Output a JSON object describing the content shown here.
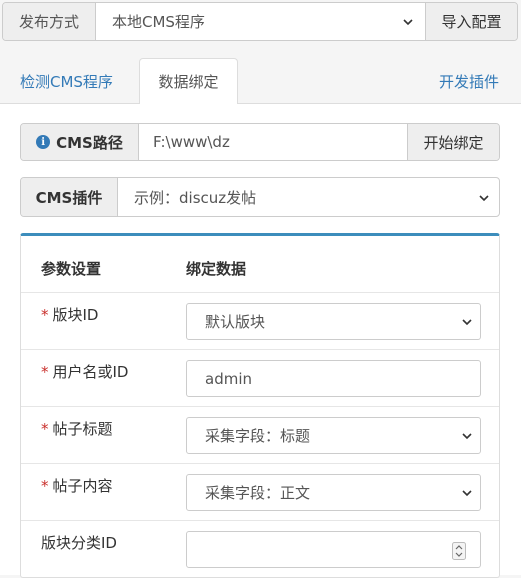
{
  "publish": {
    "label": "发布方式",
    "selected": "本地CMS程序",
    "import_button": "导入配置"
  },
  "tabs": [
    {
      "label": "检测CMS程序"
    },
    {
      "label": "数据绑定"
    },
    {
      "label": "开发插件"
    }
  ],
  "cms_path": {
    "label": "CMS路径",
    "value": "F:\\www\\dz",
    "button": "开始绑定"
  },
  "cms_plugin": {
    "label": "CMS插件",
    "selected": "示例：discuz发帖"
  },
  "table": {
    "headers": [
      "参数设置",
      "绑定数据"
    ],
    "rows": [
      {
        "required": "*",
        "label": "版块ID",
        "value": "默认版块",
        "type": "select"
      },
      {
        "required": "*",
        "label": "用户名或ID",
        "value": "admin",
        "type": "text"
      },
      {
        "required": "*",
        "label": "帖子标题",
        "value": "采集字段：标题",
        "type": "select"
      },
      {
        "required": "*",
        "label": "帖子内容",
        "value": "采集字段：正文",
        "type": "select"
      },
      {
        "required": "",
        "label": "版块分类ID",
        "value": "",
        "type": "number"
      }
    ]
  },
  "colors": {
    "link": "#337ab7",
    "required": "#c9302c",
    "panel_accent": "#3c8dbc"
  }
}
